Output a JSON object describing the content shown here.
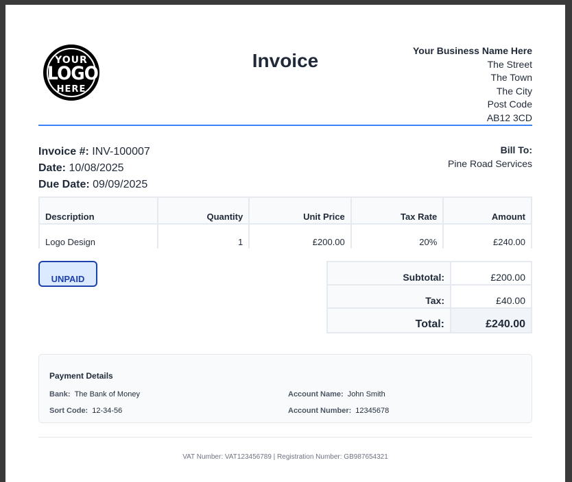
{
  "logo": {
    "line1": "YOUR",
    "line2": "LOGO",
    "line3": "HERE"
  },
  "title": "Invoice",
  "business": {
    "name": "Your Business Name Here",
    "street": "The Street",
    "town": "The Town",
    "city": "The City",
    "postcode_label": "Post Code",
    "postcode": "AB12 3CD"
  },
  "invoice": {
    "number_label": "Invoice #:",
    "number": "INV-100007",
    "date_label": "Date:",
    "date": "10/08/2025",
    "due_label": "Due Date:",
    "due": "09/09/2025"
  },
  "bill_to": {
    "label": "Bill To:",
    "name": "Pine Road Services"
  },
  "table": {
    "headers": [
      "Description",
      "Quantity",
      "Unit Price",
      "Tax Rate",
      "Amount"
    ],
    "rows": [
      {
        "description": "Logo Design",
        "quantity": "1",
        "unit_price": "£200.00",
        "tax_rate": "20%",
        "amount": "£240.00"
      }
    ]
  },
  "status": "UNPAID",
  "totals": {
    "subtotal_label": "Subtotal:",
    "subtotal": "£200.00",
    "tax_label": "Tax:",
    "tax": "£40.00",
    "total_label": "Total:",
    "total": "£240.00"
  },
  "payment": {
    "heading": "Payment Details",
    "bank_label": "Bank:",
    "bank": "The Bank of Money",
    "sort_label": "Sort Code:",
    "sort": "12-34-56",
    "acct_name_label": "Account Name:",
    "acct_name": "John Smith",
    "acct_num_label": "Account Number:",
    "acct_num": "12345678"
  },
  "footer": "VAT Number: VAT123456789 | Registration Number: GB987654321",
  "colors": {
    "accent": "#3b82f6",
    "badge": "#1e40af",
    "badge_bg": "#dbeafe"
  }
}
